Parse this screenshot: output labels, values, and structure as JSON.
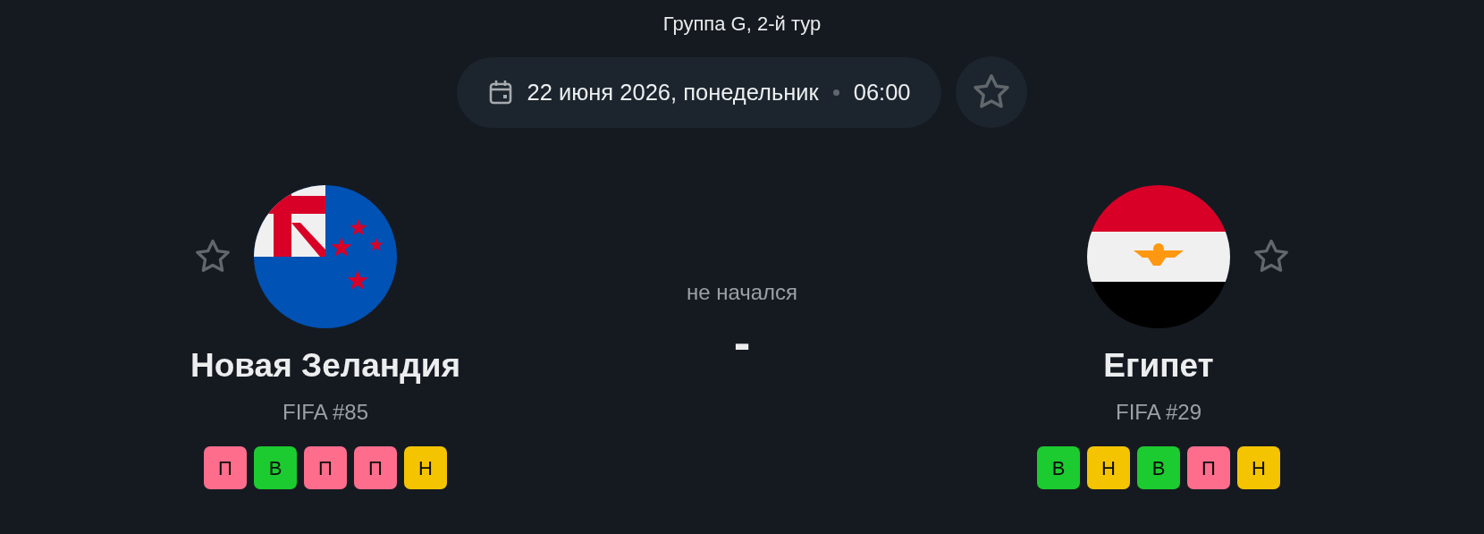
{
  "round": "Группа G, 2-й тур",
  "date": "22 июня 2026, понедельник",
  "time": "06:00",
  "status": "не начался",
  "score": "-",
  "teams": [
    {
      "name": "Новая Зеландия",
      "rank": "FIFA #85",
      "form": [
        {
          "result": "П",
          "color": "#ff6d8c"
        },
        {
          "result": "В",
          "color": "#1ccb2f"
        },
        {
          "result": "П",
          "color": "#ff6d8c"
        },
        {
          "result": "П",
          "color": "#ff6d8c"
        },
        {
          "result": "Н",
          "color": "#f5c400"
        }
      ]
    },
    {
      "name": "Египет",
      "rank": "FIFA #29",
      "form": [
        {
          "result": "В",
          "color": "#1ccb2f"
        },
        {
          "result": "Н",
          "color": "#f5c400"
        },
        {
          "result": "В",
          "color": "#1ccb2f"
        },
        {
          "result": "П",
          "color": "#ff6d8c"
        },
        {
          "result": "Н",
          "color": "#f5c400"
        }
      ]
    }
  ]
}
